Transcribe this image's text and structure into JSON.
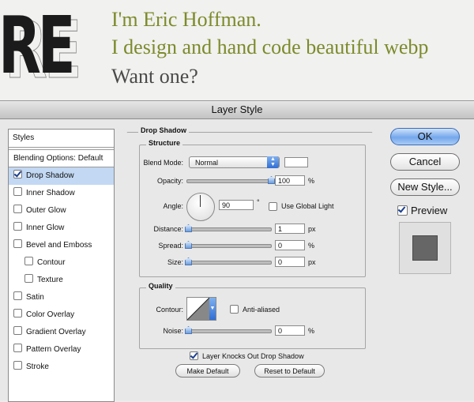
{
  "website": {
    "logo_text": "RE",
    "line1": "I'm Eric Hoffman.",
    "line2": "I design and hand code beautiful webp",
    "line3": "Want one?"
  },
  "dialog": {
    "title": "Layer Style",
    "styles_header": "Styles",
    "blending_options": "Blending Options: Default",
    "style_items": [
      {
        "label": "Drop Shadow",
        "checked": true
      },
      {
        "label": "Inner Shadow",
        "checked": false
      },
      {
        "label": "Outer Glow",
        "checked": false
      },
      {
        "label": "Inner Glow",
        "checked": false
      },
      {
        "label": "Bevel and Emboss",
        "checked": false
      },
      {
        "label": "Contour",
        "checked": false
      },
      {
        "label": "Texture",
        "checked": false
      },
      {
        "label": "Satin",
        "checked": false
      },
      {
        "label": "Color Overlay",
        "checked": false
      },
      {
        "label": "Gradient Overlay",
        "checked": false
      },
      {
        "label": "Pattern Overlay",
        "checked": false
      },
      {
        "label": "Stroke",
        "checked": false
      }
    ],
    "drop_shadow": {
      "group_title": "Drop Shadow",
      "structure_title": "Structure",
      "blend_mode_label": "Blend Mode:",
      "blend_mode_value": "Normal",
      "blend_color": "#ffffff",
      "opacity_label": "Opacity:",
      "opacity_value": "100",
      "opacity_fraction": 1.0,
      "percent_unit": "%",
      "angle_label": "Angle:",
      "angle_value": "90",
      "degree_unit": "°",
      "use_global_light": "Use Global Light",
      "distance_label": "Distance:",
      "distance_value": "1",
      "distance_fraction": 0.0,
      "px_unit": "px",
      "spread_label": "Spread:",
      "spread_value": "0",
      "spread_fraction": 0.0,
      "size_label": "Size:",
      "size_value": "0",
      "size_fraction": 0.0,
      "quality_title": "Quality",
      "contour_label": "Contour:",
      "anti_aliased": "Anti-aliased",
      "noise_label": "Noise:",
      "noise_value": "0",
      "noise_fraction": 0.0,
      "layer_knocks_out": "Layer Knocks Out Drop Shadow",
      "make_default": "Make Default",
      "reset_to_default": "Reset to Default"
    },
    "buttons": {
      "ok": "OK",
      "cancel": "Cancel",
      "new_style": "New Style...",
      "preview": "Preview"
    },
    "colors": {
      "accent_blue": "#74a7ec",
      "selection": "#c2d8f3",
      "website_green": "#7d8a2b"
    }
  }
}
